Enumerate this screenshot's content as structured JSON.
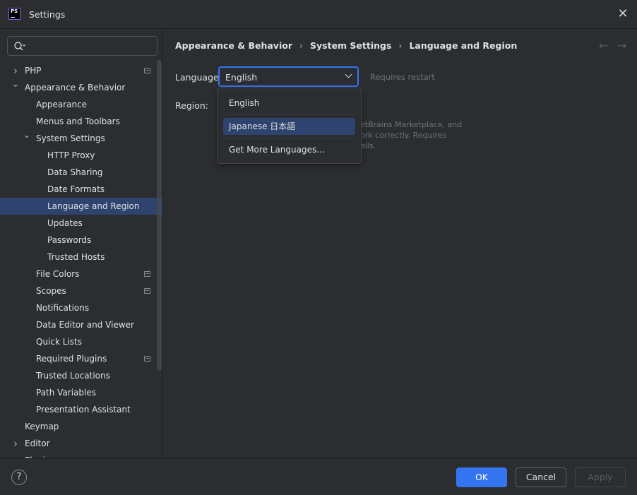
{
  "window": {
    "title": "Settings",
    "app_icon_text": "PS"
  },
  "search": {
    "placeholder": ""
  },
  "tree": [
    {
      "label": "PHP",
      "level": 0,
      "chevron": "right",
      "project": true
    },
    {
      "label": "Appearance & Behavior",
      "level": 0,
      "chevron": "down",
      "project": false
    },
    {
      "label": "Appearance",
      "level": 1,
      "chevron": "",
      "project": false
    },
    {
      "label": "Menus and Toolbars",
      "level": 1,
      "chevron": "",
      "project": false
    },
    {
      "label": "System Settings",
      "level": 1,
      "chevron": "down",
      "project": false
    },
    {
      "label": "HTTP Proxy",
      "level": 2,
      "chevron": "",
      "project": false
    },
    {
      "label": "Data Sharing",
      "level": 2,
      "chevron": "",
      "project": false
    },
    {
      "label": "Date Formats",
      "level": 2,
      "chevron": "",
      "project": false
    },
    {
      "label": "Language and Region",
      "level": 2,
      "chevron": "",
      "project": false,
      "selected": true
    },
    {
      "label": "Updates",
      "level": 2,
      "chevron": "",
      "project": false
    },
    {
      "label": "Passwords",
      "level": 2,
      "chevron": "",
      "project": false
    },
    {
      "label": "Trusted Hosts",
      "level": 2,
      "chevron": "",
      "project": false
    },
    {
      "label": "File Colors",
      "level": 1,
      "chevron": "",
      "project": true
    },
    {
      "label": "Scopes",
      "level": 1,
      "chevron": "",
      "project": true
    },
    {
      "label": "Notifications",
      "level": 1,
      "chevron": "",
      "project": false
    },
    {
      "label": "Data Editor and Viewer",
      "level": 1,
      "chevron": "",
      "project": false
    },
    {
      "label": "Quick Lists",
      "level": 1,
      "chevron": "",
      "project": false
    },
    {
      "label": "Required Plugins",
      "level": 1,
      "chevron": "",
      "project": true
    },
    {
      "label": "Trusted Locations",
      "level": 1,
      "chevron": "",
      "project": false
    },
    {
      "label": "Path Variables",
      "level": 1,
      "chevron": "",
      "project": false
    },
    {
      "label": "Presentation Assistant",
      "level": 1,
      "chevron": "",
      "project": false
    },
    {
      "label": "Keymap",
      "level": 0,
      "chevron": "",
      "project": false
    },
    {
      "label": "Editor",
      "level": 0,
      "chevron": "right",
      "project": false
    },
    {
      "label": "Plugins",
      "level": 0,
      "chevron": "",
      "project": false
    }
  ],
  "breadcrumb": [
    "Appearance & Behavior",
    "System Settings",
    "Language and Region"
  ],
  "form": {
    "language_label": "Language:",
    "language_value": "English",
    "requires_restart": "Requires restart",
    "region_label": "Region:",
    "hint_text": "etBrains Marketplace, and\nork correctly. Requires\nails."
  },
  "dropdown": {
    "options": [
      "English",
      "Japanese 日本語",
      "Get More Languages..."
    ],
    "selected_index": 1
  },
  "buttons": {
    "ok": "OK",
    "cancel": "Cancel",
    "apply": "Apply",
    "help": "?"
  },
  "colors": {
    "accent": "#3574f0",
    "selection": "#2e436e",
    "background": "#2b2d30"
  }
}
